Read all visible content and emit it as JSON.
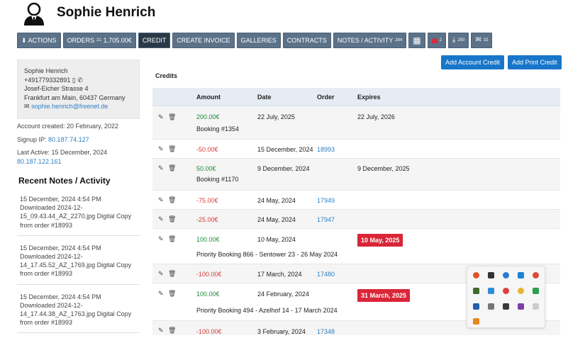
{
  "user": {
    "name": "Sophie Henrich"
  },
  "tabs": [
    {
      "label": "⬇ ACTIONS"
    },
    {
      "label": "ORDERS",
      "count": "21",
      "amount": "1,705.00€"
    },
    {
      "label": "CREDIT"
    },
    {
      "label": "CREATE INVOICE"
    },
    {
      "label": "GALLERIES"
    },
    {
      "label": "CONTRACTS"
    },
    {
      "label": "NOTES / ACTIVITY",
      "count": "284"
    },
    {
      "label": "▦"
    },
    {
      "label": "2"
    },
    {
      "label": "250"
    },
    {
      "label": "32"
    }
  ],
  "contact": {
    "name": "Sophie Henrich",
    "phone": "+491779332891",
    "street": "Josef-Eicher Strasse 4",
    "city": "Frankfurt am Main, 60437 Germany",
    "email": "sophie.henrich@freenet.de"
  },
  "meta": {
    "account_created": "Account created: 20 February, 2022",
    "signup_label": "Signup IP:",
    "signup_ip": "80.187.74.127",
    "last_active": "Last Active: 15 December, 2024",
    "last_ip": "80.187.122.161"
  },
  "recent_title": "Recent Notes / Activity",
  "notes": [
    {
      "time": "15 December, 2024 4:54 PM",
      "l1": "Downloaded 2024-12-",
      "l2": "15_09.43.44_AZ_2270.jpg Digital Copy",
      "l3": "from order #18993"
    },
    {
      "time": "15 December, 2024 4:54 PM",
      "l1": "Downloaded 2024-12-",
      "l2": "14_17.45.52_AZ_1769.jpg Digital Copy",
      "l3": "from order #18993"
    },
    {
      "time": "15 December, 2024 4:54 PM",
      "l1": "Downloaded 2024-12-",
      "l2": "14_17.44.38_AZ_1763.jpg Digital Copy",
      "l3": "from order #18993"
    }
  ],
  "buttons": {
    "add_account": "Add Account Credit",
    "add_print": "Add Print Credit"
  },
  "credits_title": "Credits",
  "columns": {
    "amount": "Amount",
    "date": "Date",
    "order": "Order",
    "expires": "Expires"
  },
  "credits": [
    {
      "amount": "200.00€",
      "date": "22 July, 2025",
      "order": "",
      "expires": "22 July, 2026",
      "desc": "Booking #1354"
    },
    {
      "amount": "-50.00€",
      "date": "15 December, 2024",
      "order": "18993",
      "expires": "",
      "desc": ""
    },
    {
      "amount": "50.00€",
      "date": "9 December, 2024",
      "order": "",
      "expires": "9 December, 2025",
      "desc": "Booking #1170"
    },
    {
      "amount": "-75.00€",
      "date": "24 May, 2024",
      "order": "17949",
      "expires": "",
      "desc": ""
    },
    {
      "amount": "-25.00€",
      "date": "24 May, 2024",
      "order": "17947",
      "expires": "",
      "desc": ""
    },
    {
      "amount": "100.00€",
      "date": "10 May, 2024",
      "order": "",
      "expires": "10 May, 2025",
      "desc": "Priority Booking 866 - Sentower 23 - 26 May 2024"
    },
    {
      "amount": "-100.00€",
      "date": "17 March, 2024",
      "order": "17480",
      "expires": "",
      "desc": ""
    },
    {
      "amount": "100.00€",
      "date": "24 February, 2024",
      "order": "",
      "expires": "31 March, 2025",
      "desc": "Priority Booking 494 - Azelhof 14 - 17 March 2024"
    },
    {
      "amount": "-100.00€",
      "date": "3 February, 2024",
      "order": "17348",
      "expires": "",
      "desc": ""
    }
  ]
}
